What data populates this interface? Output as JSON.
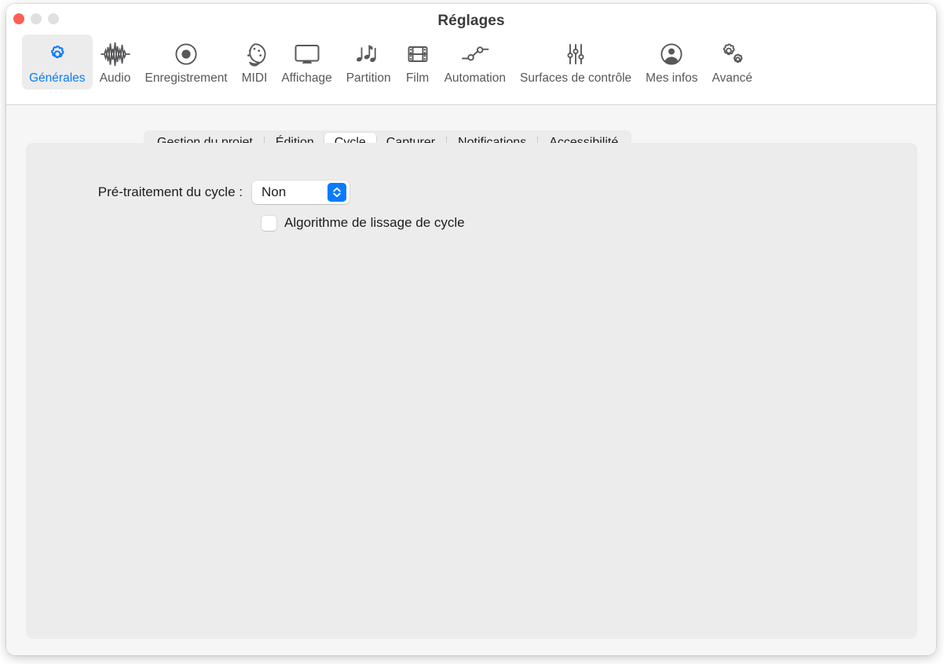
{
  "window": {
    "title": "Réglages",
    "traffic_lights": [
      {
        "name": "close",
        "color": "#ff5f57"
      },
      {
        "name": "minimize",
        "color": "#e0e0e0"
      },
      {
        "name": "zoom",
        "color": "#e0e0e0"
      }
    ]
  },
  "colors": {
    "accent": "#0a7bff",
    "toolbar_icon": "#58585a",
    "panel_bg": "#ececec",
    "body_bg": "#f6f6f6",
    "text": "#1d1d1f"
  },
  "toolbar": {
    "selected": "Générales",
    "items": [
      {
        "label": "Générales",
        "icon": "gear-icon",
        "selected": true
      },
      {
        "label": "Audio",
        "icon": "waveform-icon",
        "selected": false
      },
      {
        "label": "Enregistrement",
        "icon": "record-icon",
        "selected": false
      },
      {
        "label": "MIDI",
        "icon": "midi-connector-icon",
        "selected": false
      },
      {
        "label": "Affichage",
        "icon": "display-icon",
        "selected": false
      },
      {
        "label": "Partition",
        "icon": "music-notes-icon",
        "selected": false
      },
      {
        "label": "Film",
        "icon": "film-strip-icon",
        "selected": false
      },
      {
        "label": "Automation",
        "icon": "automation-nodes-icon",
        "selected": false
      },
      {
        "label": "Surfaces de contrôle",
        "icon": "sliders-icon",
        "selected": false
      },
      {
        "label": "Mes infos",
        "icon": "person-circle-icon",
        "selected": false
      },
      {
        "label": "Avancé",
        "icon": "double-gear-icon",
        "selected": false
      }
    ]
  },
  "tabs": {
    "selected": "Cycle",
    "items": [
      {
        "label": "Gestion du projet",
        "selected": false
      },
      {
        "label": "Édition",
        "selected": false
      },
      {
        "label": "Cycle",
        "selected": true
      },
      {
        "label": "Capturer",
        "selected": false
      },
      {
        "label": "Notifications",
        "selected": false
      },
      {
        "label": "Accessibilité",
        "selected": false
      }
    ]
  },
  "content": {
    "pretreatment": {
      "label": "Pré-traitement du cycle :",
      "value": "Non",
      "arrows_icon": "chevron-up-down-icon"
    },
    "smoothing": {
      "label": "Algorithme de lissage de cycle",
      "checked": false
    }
  }
}
